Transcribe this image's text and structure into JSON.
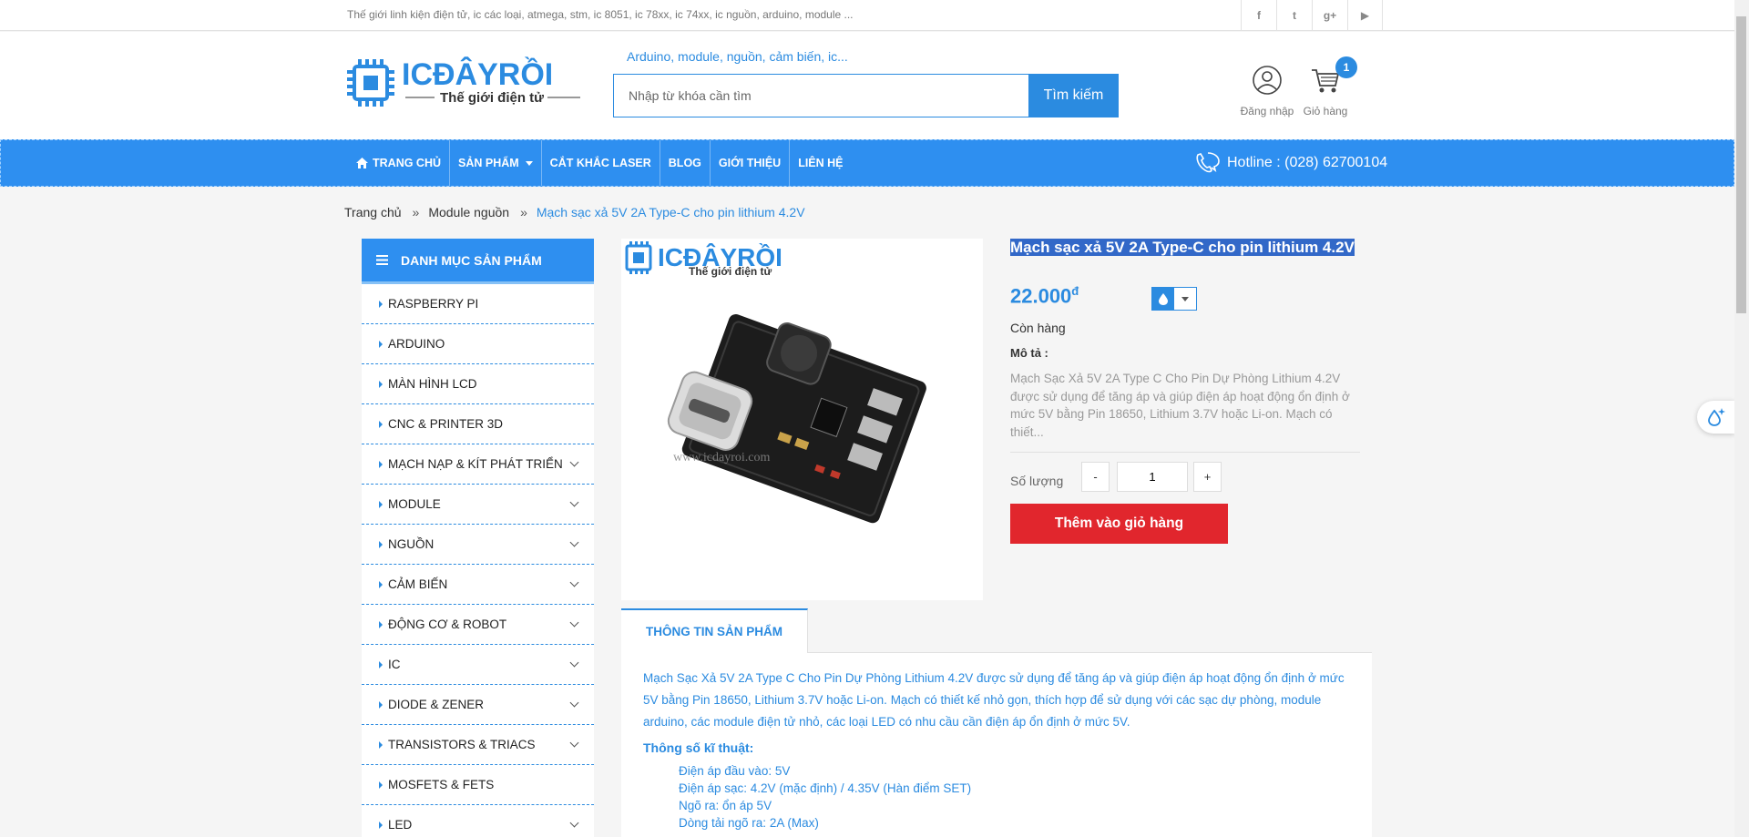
{
  "topbar": {
    "tagline": "Thế giới linh kiện điện tử, ic các loại, atmega, stm, ic 8051, ic 78xx, ic 74xx, ic nguồn, arduino, module ...",
    "socials": [
      {
        "icon": "facebook-icon",
        "label": "f"
      },
      {
        "icon": "twitter-icon",
        "label": "t"
      },
      {
        "icon": "google-plus-icon",
        "label": "g+"
      },
      {
        "icon": "youtube-icon",
        "label": "▶"
      }
    ]
  },
  "header": {
    "logo_brand": "ICĐÂYRỒI",
    "logo_tagline": "Thế giới điện tử",
    "search_hint": "Arduino, module, nguồn, cảm biến, ic...",
    "search_placeholder": "Nhập từ khóa cần tìm",
    "search_button": "Tìm kiếm",
    "login_label": "Đăng nhập",
    "cart_label": "Giỏ hàng",
    "cart_count": "1"
  },
  "nav": {
    "items": [
      {
        "label": "Trang chủ",
        "icon": "home-icon"
      },
      {
        "label": "Sản phẩm",
        "dropdown": true
      },
      {
        "label": "Cắt khắc laser"
      },
      {
        "label": "Blog"
      },
      {
        "label": "Giới thiệu"
      },
      {
        "label": "Liên hệ"
      }
    ],
    "hotline": "Hotline : (028) 62700104"
  },
  "breadcrumb": {
    "home": "Trang chủ",
    "category": "Module nguồn",
    "current": "Mạch sạc xả 5V 2A Type-C cho pin lithium 4.2V"
  },
  "sidebar": {
    "title": "Danh mục sản phẩm",
    "items": [
      {
        "label": "RASPBERRY PI",
        "expandable": false
      },
      {
        "label": "ARDUINO",
        "expandable": false
      },
      {
        "label": "MÀN HÌNH LCD",
        "expandable": false
      },
      {
        "label": "CNC & PRINTER 3D",
        "expandable": false
      },
      {
        "label": "MẠCH NẠP & KÍT PHÁT TRIỂN",
        "expandable": true
      },
      {
        "label": "MODULE",
        "expandable": true
      },
      {
        "label": "NGUỒN",
        "expandable": true
      },
      {
        "label": "CẢM BIẾN",
        "expandable": true
      },
      {
        "label": "ĐỘNG CƠ & ROBOT",
        "expandable": true
      },
      {
        "label": "IC",
        "expandable": true
      },
      {
        "label": "DIODE & ZENER",
        "expandable": true
      },
      {
        "label": "TRANSISTORS & TRIACS",
        "expandable": true
      },
      {
        "label": "MOSFETS & FETS",
        "expandable": false
      },
      {
        "label": "LED",
        "expandable": true
      }
    ]
  },
  "product": {
    "image_watermark_brand": "ICĐÂYRỒI",
    "image_watermark_tagline": "Thế giới điện tử",
    "image_url_text": "www.icdayroi.com",
    "title": "Mạch sạc xả 5V 2A Type-C cho pin lithium 4.2V",
    "price": "22.000",
    "currency": "đ",
    "stock": "Còn hàng",
    "desc_heading": "Mô tả :",
    "desc_short": "Mạch Sạc Xả 5V 2A Type C Cho Pin Dự Phòng Lithium 4.2V được sử dụng để tăng áp và giúp điện áp hoạt động ổn định ở mức 5V bằng Pin 18650, Lithium 3.7V hoặc Li-on. Mạch có thiết...",
    "qty_label": "Số lượng",
    "qty_minus": "-",
    "qty_plus": "+",
    "qty_value": "1",
    "add_to_cart": "Thêm vào giỏ hàng",
    "accent_color": "#2b8be0",
    "cta_color": "#e1262d"
  },
  "tabs": {
    "active_label": "Thông tin sản phẩm",
    "paragraph": "Mạch Sạc Xả 5V 2A Type C Cho Pin Dự Phòng Lithium 4.2V được sử dụng để tăng áp và giúp điện áp hoạt động ổn định ở mức 5V bằng Pin 18650, Lithium 3.7V hoặc Li-on. Mạch có thiết kế nhỏ gọn, thích hợp để sử dụng với các sạc dự phòng, module arduino, các module điện tử nhỏ, các loại LED có nhu cầu cần điện áp ổn định ở mức 5V.",
    "spec_heading": "Thông số kĩ thuật:",
    "specs": [
      "Điện áp đầu vào: 5V",
      "Điện áp sạc: 4.2V (mặc định) / 4.35V (Hàn điểm SET)",
      "Ngõ ra: ổn áp 5V",
      "Dòng tải ngõ ra: 2A (Max)"
    ]
  }
}
